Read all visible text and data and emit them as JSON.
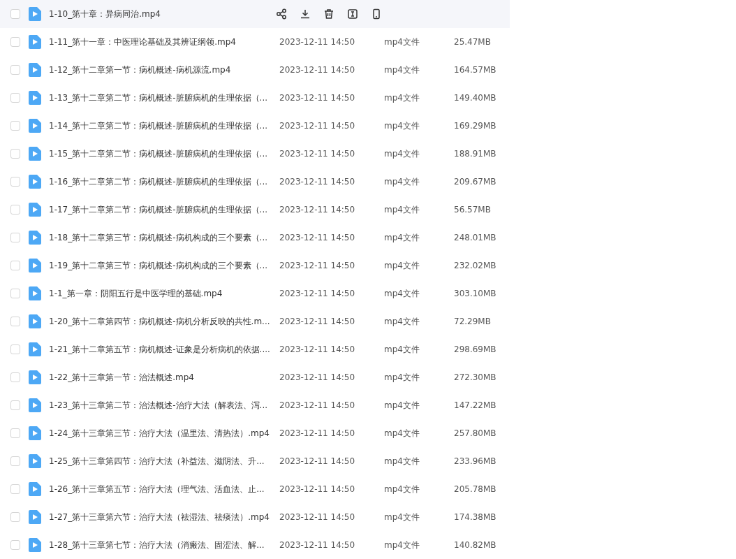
{
  "files": [
    {
      "kind": "hovered",
      "checked": false,
      "name": "1-10_第十章：异病同治.mp4"
    },
    {
      "kind": "file",
      "checked": false,
      "name": "1-11_第十一章：中医理论基础及其辨证纲领.mp4",
      "date": "2023-12-11 14:50",
      "type": "mp4文件",
      "size": "25.47MB"
    },
    {
      "kind": "file",
      "checked": false,
      "name": "1-12_第十二章第一节：病机概述-病机源流.mp4",
      "date": "2023-12-11 14:50",
      "type": "mp4文件",
      "size": "164.57MB"
    },
    {
      "kind": "file",
      "checked": false,
      "name": "1-13_第十二章第二节：病机概述-脏腑病机的生理依据（...",
      "date": "2023-12-11 14:50",
      "type": "mp4文件",
      "size": "149.40MB"
    },
    {
      "kind": "file",
      "checked": false,
      "name": "1-14_第十二章第二节：病机概述-脏腑病机的生理依据（...",
      "date": "2023-12-11 14:50",
      "type": "mp4文件",
      "size": "169.29MB"
    },
    {
      "kind": "file",
      "checked": false,
      "name": "1-15_第十二章第二节：病机概述-脏腑病机的生理依据（...",
      "date": "2023-12-11 14:50",
      "type": "mp4文件",
      "size": "188.91MB"
    },
    {
      "kind": "file",
      "checked": false,
      "name": "1-16_第十二章第二节：病机概述-脏腑病机的生理依据（...",
      "date": "2023-12-11 14:50",
      "type": "mp4文件",
      "size": "209.67MB"
    },
    {
      "kind": "file",
      "checked": false,
      "name": "1-17_第十二章第二节：病机概述-脏腑病机的生理依据（...",
      "date": "2023-12-11 14:50",
      "type": "mp4文件",
      "size": "56.57MB"
    },
    {
      "kind": "file",
      "checked": false,
      "name": "1-18_第十二章第三节：病机概述-病机构成的三个要素（...",
      "date": "2023-12-11 14:50",
      "type": "mp4文件",
      "size": "248.01MB"
    },
    {
      "kind": "file",
      "checked": false,
      "name": "1-19_第十二章第三节：病机概述-病机构成的三个要素（...",
      "date": "2023-12-11 14:50",
      "type": "mp4文件",
      "size": "232.02MB"
    },
    {
      "kind": "file",
      "checked": false,
      "name": "1-1_第一章：阴阳五行是中医学理的基础.mp4",
      "date": "2023-12-11 14:50",
      "type": "mp4文件",
      "size": "303.10MB"
    },
    {
      "kind": "file",
      "checked": false,
      "name": "1-20_第十二章第四节：病机概述-病机分析反映的共性.m...",
      "date": "2023-12-11 14:50",
      "type": "mp4文件",
      "size": "72.29MB"
    },
    {
      "kind": "file",
      "checked": false,
      "name": "1-21_第十二章第五节：病机概述-证象是分析病机的依据....",
      "date": "2023-12-11 14:50",
      "type": "mp4文件",
      "size": "298.69MB"
    },
    {
      "kind": "file",
      "checked": false,
      "name": "1-22_第十三章第一节：治法概述.mp4",
      "date": "2023-12-11 14:50",
      "type": "mp4文件",
      "size": "272.30MB"
    },
    {
      "kind": "file",
      "checked": false,
      "name": "1-23_第十三章第二节：治法概述-治疗大法（解表法、泻...",
      "date": "2023-12-11 14:50",
      "type": "mp4文件",
      "size": "147.22MB"
    },
    {
      "kind": "file",
      "checked": false,
      "name": "1-24_第十三章第三节：治疗大法（温里法、清热法）.mp4",
      "date": "2023-12-11 14:50",
      "type": "mp4文件",
      "size": "257.80MB"
    },
    {
      "kind": "file",
      "checked": false,
      "name": "1-25_第十三章第四节：治疗大法（补益法、滋阴法、升...",
      "date": "2023-12-11 14:50",
      "type": "mp4文件",
      "size": "233.96MB"
    },
    {
      "kind": "file",
      "checked": false,
      "name": "1-26_第十三章第五节：治疗大法（理气法、活血法、止...",
      "date": "2023-12-11 14:50",
      "type": "mp4文件",
      "size": "205.78MB"
    },
    {
      "kind": "file",
      "checked": false,
      "name": "1-27_第十三章第六节：治疗大法（祛湿法、祛痰法）.mp4",
      "date": "2023-12-11 14:50",
      "type": "mp4文件",
      "size": "174.38MB"
    },
    {
      "kind": "file",
      "checked": false,
      "name": "1-28_第十三章第七节：治疗大法（消瘢法、固涩法、解...",
      "date": "2023-12-11 14:50",
      "type": "mp4文件",
      "size": "140.82MB"
    }
  ]
}
